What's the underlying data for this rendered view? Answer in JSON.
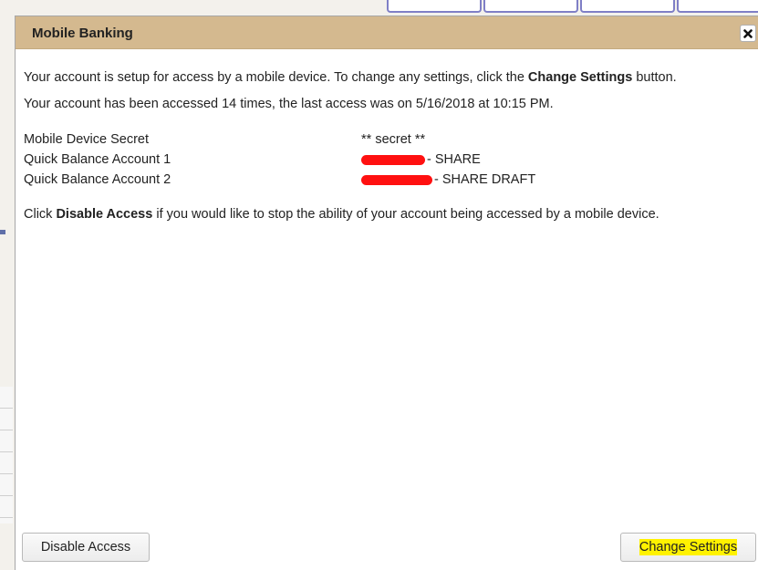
{
  "dialog": {
    "title": "Mobile Banking",
    "close_icon": "close-icon"
  },
  "content": {
    "intro_text": "Your account is setup for access by a mobile device. To change any settings, click the ",
    "intro_bold": "Change Settings",
    "intro_end": " button.",
    "access_text": "Your account has been accessed 14 times, the last access was on 5/16/2018 at 10:15 PM.",
    "rows": [
      {
        "label": "Mobile Device Secret",
        "value": "** secret **"
      },
      {
        "label": "Quick Balance Account 1",
        "value": "- SHARE"
      },
      {
        "label": "Quick Balance Account 2",
        "value": "- SHARE DRAFT"
      }
    ],
    "disable_pre": "Click ",
    "disable_bold": "Disable Access",
    "disable_post": " if you would like to stop the ability of your account being accessed by a mobile device."
  },
  "buttons": {
    "disable_label": "Disable Access",
    "change_label": "Change Settings"
  },
  "colors": {
    "titlebar": "#d4b98f",
    "redaction": "#ff1010",
    "highlight": "#fff200"
  }
}
